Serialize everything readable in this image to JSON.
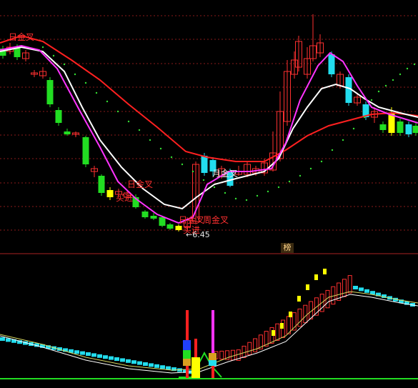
{
  "upper_panel": {
    "annotations": [
      {
        "text": "日金叉",
        "color": "#ff3030"
      },
      {
        "text": "日金叉",
        "color": "#ff3030"
      },
      {
        "text": "买进",
        "color": "#ff3030"
      },
      {
        "text": "日金叉",
        "color": "#ff3030"
      },
      {
        "text": "周金叉",
        "color": "#ff3030"
      },
      {
        "text": "买进",
        "color": "#ff3030"
      },
      {
        "text": "月金叉",
        "color": "#ffffff"
      }
    ],
    "low_price_marker": "←6.45"
  },
  "divider_badge": "榜",
  "colors": {
    "background": "#000000",
    "up_candle": "#ff3030",
    "down_candle_cyan": "#22ddee",
    "down_candle_green": "#22dd22",
    "ma_white": "#ffffff",
    "ma_magenta": "#ff33ff",
    "ma_red": "#ff2020",
    "dotted_green": "#33dd33",
    "divider": "#aa2222",
    "yellow_bar": "#ffff00"
  }
}
